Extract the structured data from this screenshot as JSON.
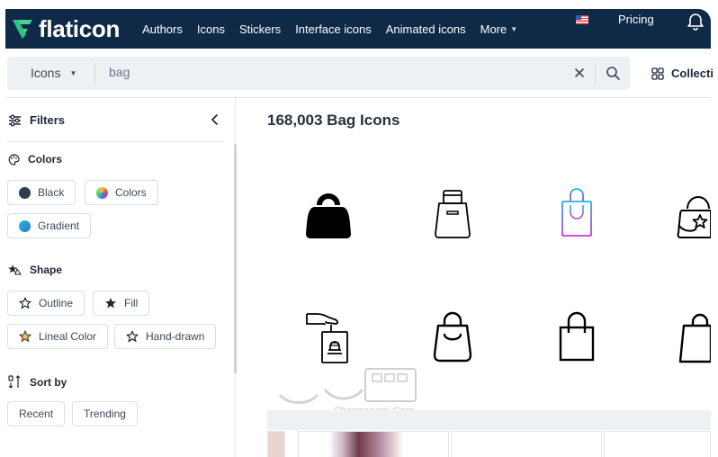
{
  "nav": {
    "brand": "flaticon",
    "links": [
      "Authors",
      "Icons",
      "Stickers",
      "Interface icons",
      "Animated icons",
      "More"
    ],
    "pricing": "Pricing",
    "colors": {
      "bg": "#0e2a47",
      "brand_accent": "#4ad295"
    }
  },
  "search": {
    "type_label": "Icons",
    "query": "bag",
    "collections_label": "Collecti"
  },
  "sidebar": {
    "filters_label": "Filters",
    "colors": {
      "title": "Colors",
      "options": [
        {
          "label": "Black",
          "swatch": "#2d3e50"
        },
        {
          "label": "Colors",
          "swatch": "multicolor"
        },
        {
          "label": "Gradient",
          "swatch": "gradient"
        }
      ]
    },
    "shape": {
      "title": "Shape",
      "options": [
        "Outline",
        "Fill",
        "Lineal Color",
        "Hand-drawn"
      ]
    },
    "sort": {
      "title": "Sort by",
      "options": [
        "Recent",
        "Trending"
      ]
    }
  },
  "main": {
    "result_title": "168,003 Bag Icons",
    "icons": [
      "kettlebell-bag-fill-icon",
      "tote-bag-outline-icon",
      "shopping-bag-gradient-icon",
      "handbag-star-icon",
      "hand-holding-bag-icon",
      "shopping-bag-handle-icon",
      "shopping-bag-outline-icon",
      "shopping-bag-cropped-icon"
    ]
  },
  "watermark": "Chegooneg!.Com"
}
